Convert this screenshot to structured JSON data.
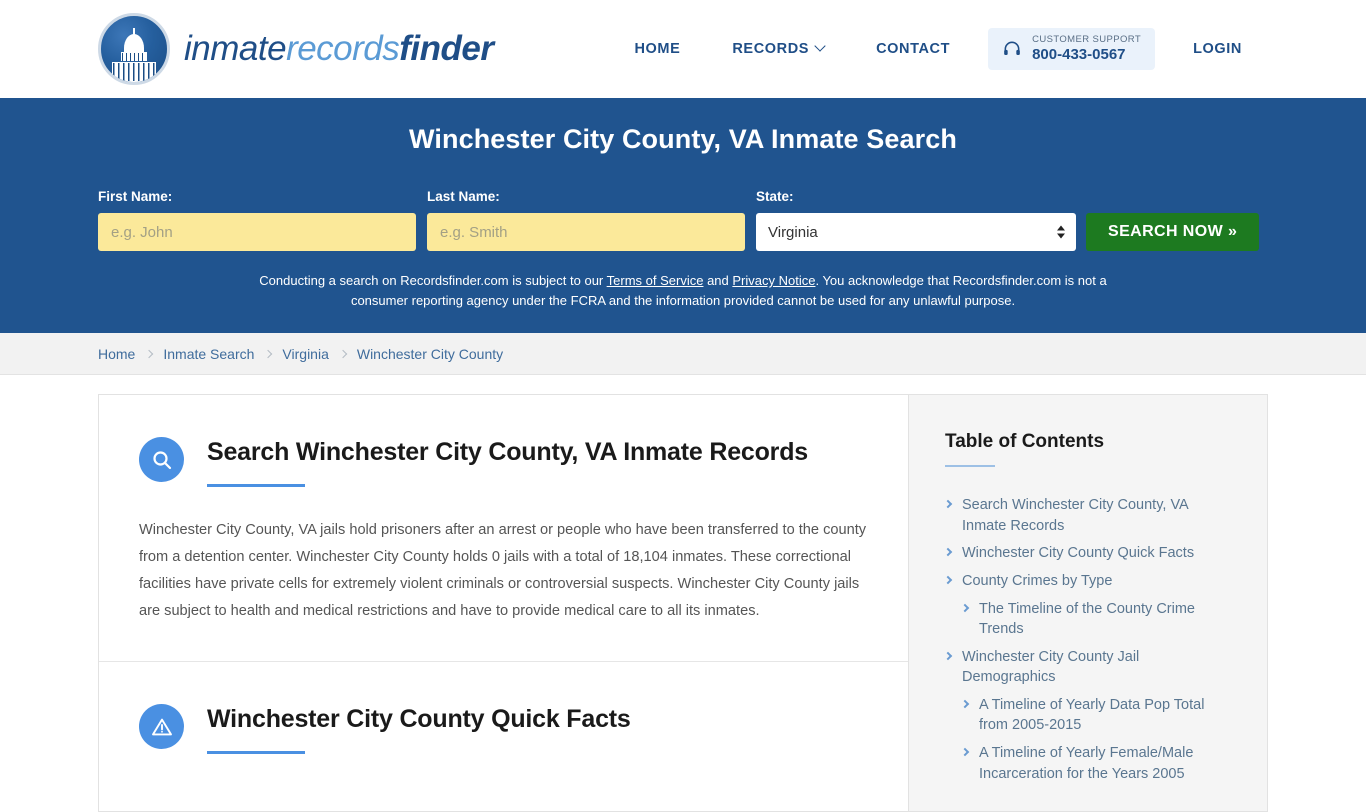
{
  "header": {
    "logo": {
      "icon": "capitol-dome-icon",
      "part1": "inmate",
      "part2": "records",
      "part3": "finder"
    },
    "nav": [
      {
        "label": "HOME",
        "has_caret": false
      },
      {
        "label": "RECORDS",
        "has_caret": true
      },
      {
        "label": "CONTACT",
        "has_caret": false
      }
    ],
    "support": {
      "icon": "headset-icon",
      "label": "CUSTOMER SUPPORT",
      "phone": "800-433-0567"
    },
    "login_label": "LOGIN"
  },
  "hero": {
    "title": "Winchester City County, VA Inmate Search",
    "first_name": {
      "label": "First Name:",
      "value": "",
      "placeholder": "e.g. John"
    },
    "last_name": {
      "label": "Last Name:",
      "value": "",
      "placeholder": "e.g. Smith"
    },
    "state": {
      "label": "State:",
      "value": "Virginia"
    },
    "search_button": "SEARCH NOW »",
    "disclaimer": {
      "part1": "Conducting a search on Recordsfinder.com is subject to our ",
      "link1": "Terms of Service",
      "part2": " and ",
      "link2": "Privacy Notice",
      "part3": ". You acknowledge that Recordsfinder.com is not a consumer reporting agency under the FCRA and the information provided cannot be used for any unlawful purpose."
    }
  },
  "breadcrumb": [
    "Home",
    "Inmate Search",
    "Virginia",
    "Winchester City County"
  ],
  "sections": [
    {
      "icon": "search-circle-icon",
      "title": "Search Winchester City County, VA Inmate Records",
      "body": "Winchester City County, VA jails hold prisoners after an arrest or people who have been transferred to the county from a detention center. Winchester City County holds 0 jails with a total of 18,104 inmates. These correctional facilities have private cells for extremely violent criminals or controversial suspects. Winchester City County jails are subject to health and medical restrictions and have to provide medical care to all its inmates."
    },
    {
      "icon": "warning-circle-icon",
      "title": "Winchester City County Quick Facts",
      "body": ""
    }
  ],
  "toc": {
    "title": "Table of Contents",
    "items": [
      {
        "label": "Search Winchester City County, VA Inmate Records",
        "level": 1
      },
      {
        "label": "Winchester City County Quick Facts",
        "level": 1
      },
      {
        "label": "County Crimes by Type",
        "level": 1
      },
      {
        "label": "The Timeline of the County Crime Trends",
        "level": 2
      },
      {
        "label": "Winchester City County Jail Demographics",
        "level": 1
      },
      {
        "label": "A Timeline of Yearly Data Pop Total from 2005-2015",
        "level": 2
      },
      {
        "label": "A Timeline of Yearly Female/Male Incarceration for the Years 2005",
        "level": 2
      }
    ]
  },
  "colors": {
    "hero_blue": "#20548f",
    "brand_blue": "#1f4e87",
    "accent_blue": "#4a90e2",
    "button_green": "#1d7a20",
    "input_yellow": "#fbe99a"
  }
}
